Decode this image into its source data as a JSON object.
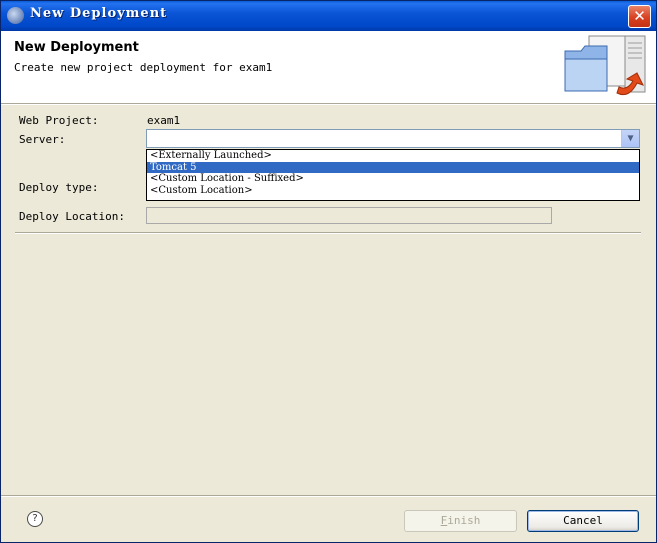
{
  "window": {
    "title": "New Deployment",
    "close_glyph": "✕"
  },
  "header": {
    "title": "New Deployment",
    "description": "Create new project deployment for exam1",
    "icon": "deploy-wizard-icon"
  },
  "form": {
    "web_project_label": "Web Project:",
    "web_project_value": "exam1",
    "server_label": "Server:",
    "server_value": "",
    "deploy_type_label": "Deploy type:",
    "deploy_location_label": "Deploy Location:",
    "deploy_location_value": ""
  },
  "server_dropdown": {
    "options": [
      "<Externally Launched>",
      "Tomcat 5",
      "<Custom Location - Suffixed>",
      "<Custom Location>"
    ],
    "highlighted": "Tomcat 5"
  },
  "footer": {
    "help_glyph": "?",
    "finish_mnemonic": "F",
    "finish_rest": "inish",
    "finish_enabled": false,
    "cancel_label": "Cancel"
  },
  "colors": {
    "titlebar": "#0a55d6",
    "selection": "#316ac5",
    "dialog_bg": "#ece9d8"
  }
}
